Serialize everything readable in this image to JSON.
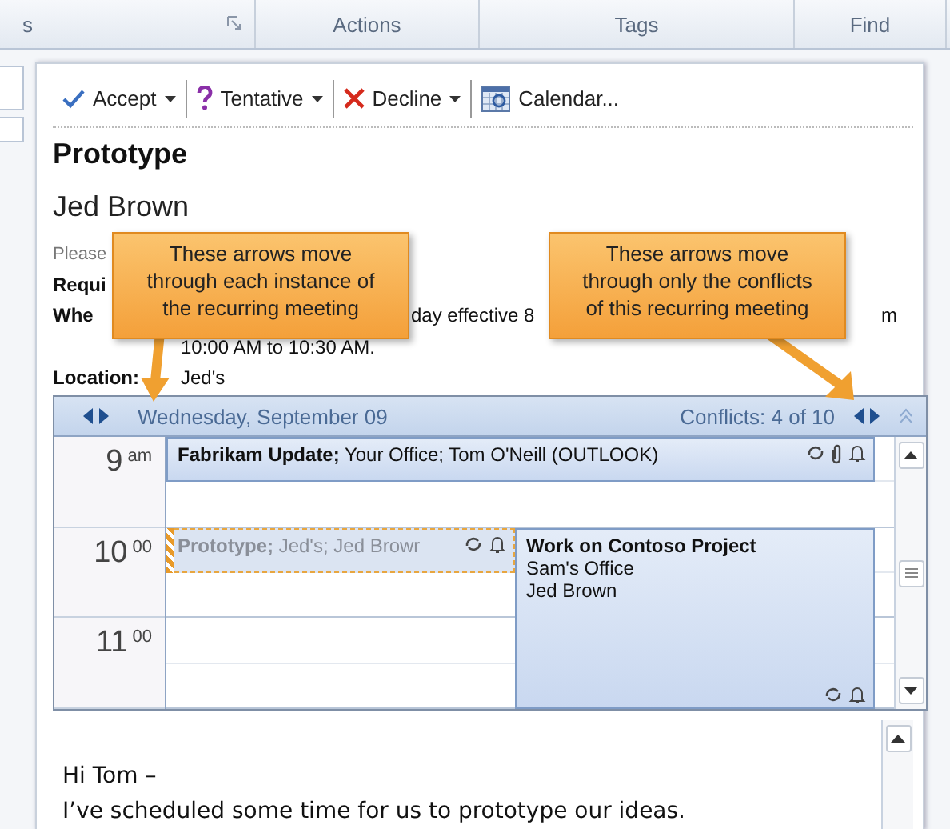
{
  "ribbon": {
    "groups": [
      {
        "label": "s",
        "launcher": true
      },
      {
        "label": "Actions",
        "launcher": false
      },
      {
        "label": "Tags",
        "launcher": false
      },
      {
        "label": "Find",
        "launcher": false
      }
    ]
  },
  "toolbar": {
    "buttons": [
      {
        "kind": "accept",
        "label": "Accept",
        "dropdown": true
      },
      {
        "kind": "tentative",
        "label": "Tentative",
        "dropdown": true
      },
      {
        "kind": "decline",
        "label": "Decline",
        "dropdown": true
      },
      {
        "kind": "calendar",
        "label": "Calendar...",
        "dropdown": false
      }
    ]
  },
  "message": {
    "subject": "Prototype",
    "sender": "Jed Brown",
    "info": "Please",
    "fields": [
      {
        "label": "Requi"
      },
      {
        "label": "Whe",
        "value": "day effective 8",
        "value_end": "m",
        "continuation": "10:00 AM to 10:30 AM."
      },
      {
        "label": "Location:",
        "value": "Jed's"
      }
    ]
  },
  "calendar": {
    "date": "Wednesday, September 09",
    "conflicts": "Conflicts: 4 of 10",
    "hours": [
      {
        "hour": "9",
        "suffix": "am"
      },
      {
        "hour": "10",
        "suffix": "00"
      },
      {
        "hour": "11",
        "suffix": "00"
      }
    ],
    "events": [
      {
        "kind": "busy",
        "text": "**Fabrikam Update;** Your Office; Tom O'Neill (OUTLOOK)",
        "attachment": true
      },
      {
        "kind": "tentative",
        "text": "**Prototype;** Jed's; Jed Browr",
        "attachment": false
      },
      {
        "kind": "block",
        "title": "Work on Contoso Project",
        "lines": [
          "Sam's Office",
          "Jed Brown"
        ],
        "attachment": false
      }
    ]
  },
  "body": {
    "lines": [
      "Hi Tom –",
      "I’ve scheduled some time for us to prototype our ideas."
    ]
  },
  "callouts": [
    {
      "text": "These arrows move through each instance of the recurring meeting"
    },
    {
      "text": "These arrows move through only the conflicts of this recurring meeting"
    }
  ]
}
